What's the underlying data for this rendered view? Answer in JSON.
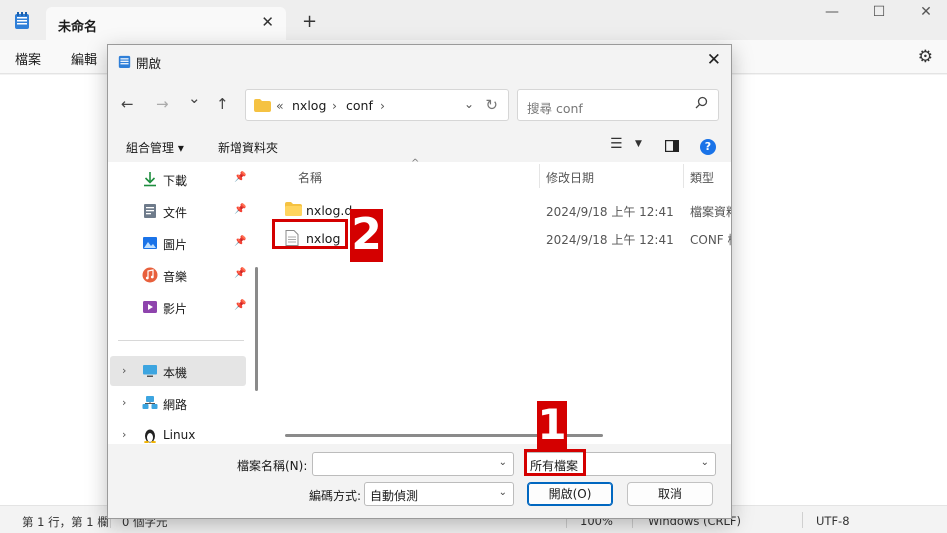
{
  "notepad": {
    "tab_title": "未命名",
    "tab_close": "✕",
    "new_tab": "+",
    "window_controls": {
      "minimize": "—",
      "maximize": "☐",
      "close": "✕"
    },
    "menu": [
      "檔案",
      "編輯"
    ],
    "status": {
      "position": "第 1 行，第 1 欄",
      "chars": "0 個字元",
      "zoom": "100%",
      "line_ending": "Windows (CRLF)",
      "encoding": "UTF-8"
    }
  },
  "dialog": {
    "title": "開啟",
    "close": "✕",
    "nav": {
      "back": "←",
      "forward": "→",
      "recent": "⌄",
      "up": "↑"
    },
    "address": {
      "prefix": "«",
      "segments": [
        "nxlog",
        "conf"
      ],
      "separator": "›"
    },
    "search_placeholder": "搜尋 conf",
    "toolbar": {
      "organize": "組合管理 ▾",
      "new_folder": "新增資料夾"
    },
    "nav_pane": [
      {
        "label": "下載",
        "icon": "download-icon",
        "pinned": true
      },
      {
        "label": "文件",
        "icon": "document-icon",
        "pinned": true
      },
      {
        "label": "圖片",
        "icon": "picture-icon",
        "pinned": true
      },
      {
        "label": "音樂",
        "icon": "music-icon",
        "pinned": true
      },
      {
        "label": "影片",
        "icon": "video-icon",
        "pinned": true
      },
      {
        "label": "本機",
        "icon": "computer-icon",
        "expandable": true,
        "selected": true
      },
      {
        "label": "網路",
        "icon": "network-icon",
        "expandable": true
      },
      {
        "label": "Linux",
        "icon": "linux-icon",
        "expandable": true
      }
    ],
    "columns": {
      "name": "名稱",
      "modified": "修改日期",
      "type": "類型"
    },
    "files": [
      {
        "name": "nxlog.d",
        "modified": "2024/9/18 上午 12:41",
        "type": "檔案資料夾",
        "icon": "folder-icon"
      },
      {
        "name": "nxlog",
        "modified": "2024/9/18 上午 12:41",
        "type": "CONF 檔案",
        "icon": "file-icon"
      }
    ],
    "file_name_label": "檔案名稱(N):",
    "file_name_value": "",
    "file_type_value": "所有檔案",
    "encoding_label": "編碼方式:",
    "encoding_value": "自動偵測",
    "open_button": "開啟(O)",
    "cancel_button": "取消"
  },
  "annotations": {
    "marker_1": "1",
    "marker_2": "2"
  },
  "colors": {
    "accent": "#0067c0",
    "annotation": "#d40000",
    "folder": "#f5c242"
  }
}
